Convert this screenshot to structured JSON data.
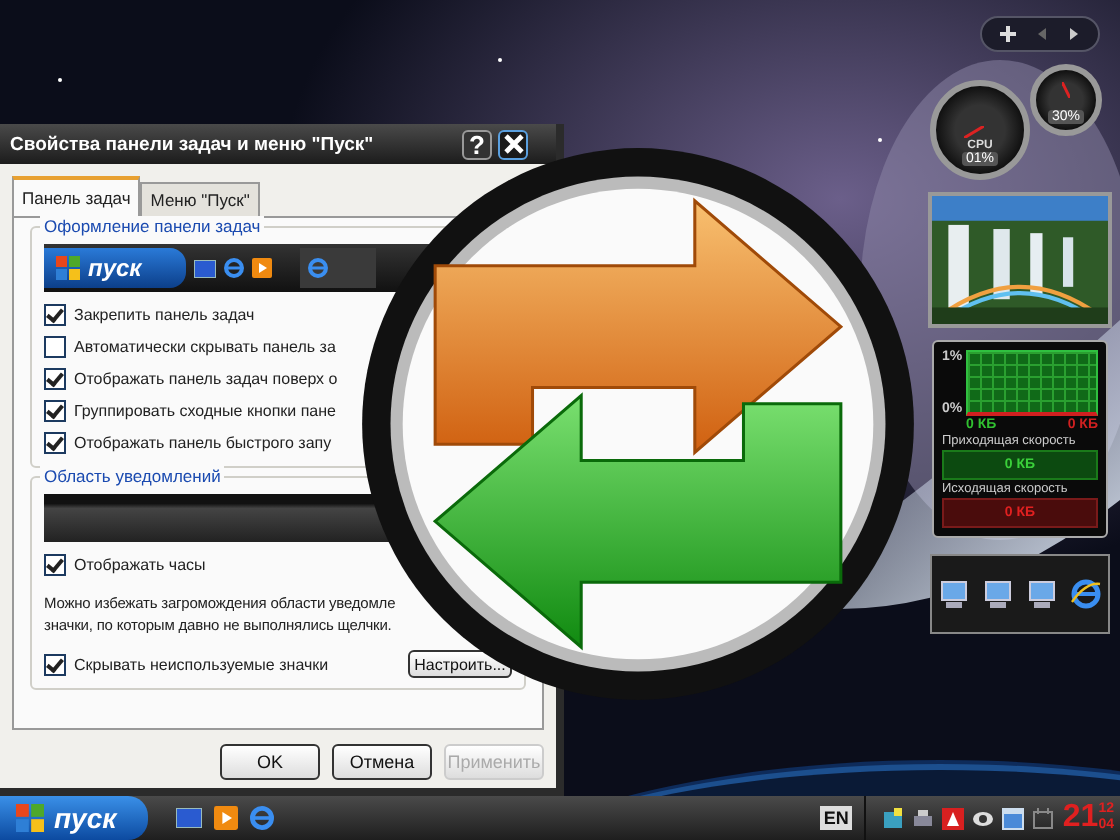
{
  "dialog": {
    "title": "Свойства панели задач и меню \"Пуск\"",
    "help_button": "?",
    "tabs": [
      {
        "label": "Панель задач",
        "selected": true
      },
      {
        "label": "Меню \"Пуск\"",
        "selected": false
      }
    ],
    "appearance": {
      "title": "Оформление панели задач",
      "preview_start": "пуск",
      "options": [
        {
          "label": "Закрепить панель задач",
          "checked": true
        },
        {
          "label": "Автоматически скрывать панель за",
          "checked": false
        },
        {
          "label": "Отображать панель задач поверх о",
          "checked": true
        },
        {
          "label": "Группировать сходные кнопки пане",
          "checked": true
        },
        {
          "label": "Отображать панель быстрого запу",
          "checked": true
        }
      ]
    },
    "notification": {
      "title": "Область уведомлений",
      "options": [
        {
          "label": "Отображать часы",
          "checked": true
        }
      ],
      "note_lines": [
        "Можно избежать загромождения области уведомле",
        "значки, по которым давно не выполнялись щелчки."
      ],
      "hide_option": {
        "label": "Скрывать неиспользуемые значки",
        "checked": true
      },
      "customize_button": "Настроить..."
    },
    "buttons": [
      {
        "label": "OK",
        "disabled": false
      },
      {
        "label": "Отмена",
        "disabled": false
      },
      {
        "label": "Применить",
        "disabled": true
      }
    ]
  },
  "gadgets": {
    "gauges": [
      {
        "label": "CPU",
        "reading": "01%"
      },
      {
        "reading": "30%"
      }
    ],
    "network": {
      "y_max": "1%",
      "y_min": "0%",
      "in_axis": "0 КБ",
      "out_axis": "0 КБ",
      "incoming": {
        "label": "Приходящая скорость",
        "value": "0 КБ"
      },
      "outgoing": {
        "label": "Исходящая скорость",
        "value": "0 КБ"
      }
    }
  },
  "taskbar": {
    "start_label": "пуск",
    "language": "EN",
    "clock": {
      "hours": "21",
      "minutes": "12",
      "seconds": "04"
    }
  }
}
